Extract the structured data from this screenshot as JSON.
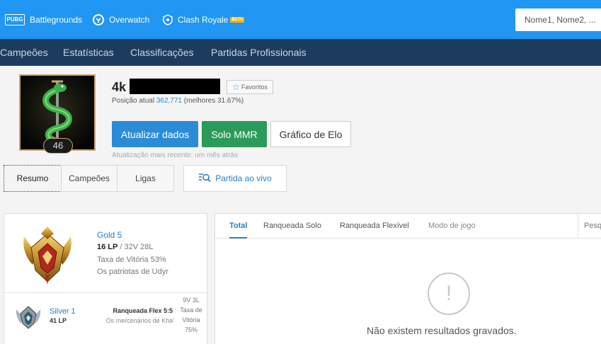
{
  "games": [
    {
      "label": "Battlegrounds",
      "icon": "pubg-icon",
      "icon_text": "PUBG"
    },
    {
      "label": "Overwatch",
      "icon": "overwatch-icon"
    },
    {
      "label": "Clash Royale",
      "icon": "clash-royale-icon",
      "badge": "BETA"
    }
  ],
  "search": {
    "placeholder": "Nome1, Nome2, ..."
  },
  "nav": [
    "Campeões",
    "Estatísticas",
    "Classificações",
    "Partidas Profissionais"
  ],
  "profile": {
    "name_prefix": "4k",
    "level": "46",
    "favorite_label": "Favoritos",
    "rank_prefix": "Posição atual",
    "rank_position": "362,771",
    "rank_suffix": "(melhores 31.67%)",
    "last_update": "Atualização mais recente: um mês atrás"
  },
  "actions": {
    "update": "Atualizar dados",
    "solo_mmr": "Solo MMR",
    "elo_chart": "Gráfico de Elo"
  },
  "tabs": {
    "resumo": "Resumo",
    "campeoes": "Campeões",
    "ligas": "Ligas",
    "live": "Partida ao vivo"
  },
  "solo_rank": {
    "tier": "Gold 5",
    "lp": "16 LP",
    "record": " / 32V 28L",
    "winrate": "Taxa de Vitória 53%",
    "league": "Os patriotas de Udyr"
  },
  "flex_rank": {
    "tier": "Silver 1",
    "lp": "41 LP",
    "queue": "Ranqueada Flex 5:5",
    "league": "Os mercenários de Kha'",
    "record": "9V 3L",
    "winrate_label": "Taxa de Vitória",
    "winrate": "75%"
  },
  "filters": [
    "Total",
    "Ranqueada Solo",
    "Ranqueada Flexível",
    "Modo de jogo"
  ],
  "filter_search": "Pesq",
  "empty": {
    "message": "Não existem resultados gravados."
  },
  "colors": {
    "topbar": "#2196f3",
    "navbar": "#1d3b5e",
    "update_button": "#2c8bd6",
    "solo_button": "#2c9a5a",
    "link_blue": "#2a7fc4"
  }
}
